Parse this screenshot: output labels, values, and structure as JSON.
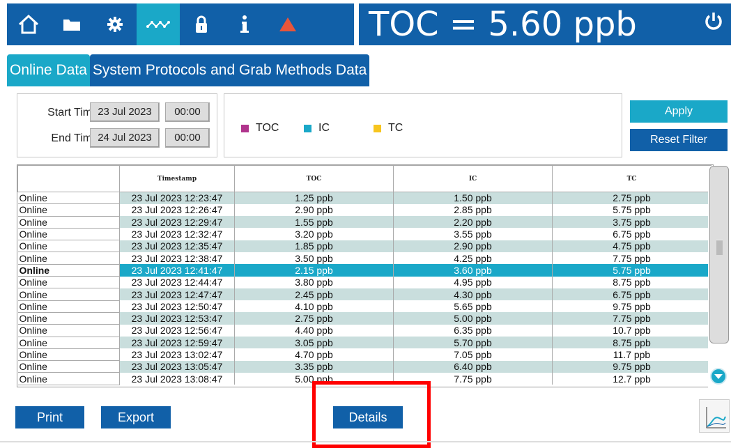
{
  "header": {
    "title": "TOC = 5.60 ppb",
    "nav_icons": [
      "home-icon",
      "folder-icon",
      "gear-icon",
      "waveform-icon",
      "lock-icon",
      "info-icon",
      "alert-triangle-icon"
    ],
    "active_nav": 3,
    "alert_color": "#e8553a"
  },
  "tabs": [
    {
      "label": "Online Data",
      "active": true
    },
    {
      "label": "System Protocols and Grab Methods Data",
      "active": false
    }
  ],
  "filter": {
    "start_label": "Start Time",
    "start_date": "23 Jul 2023",
    "start_time": "00:00",
    "end_label": "End Time",
    "end_date": "24 Jul 2023",
    "end_time": "00:00"
  },
  "legend": [
    {
      "label": "TOC",
      "color": "#b0348c"
    },
    {
      "label": "IC",
      "color": "#1aa8c8"
    },
    {
      "label": "TC",
      "color": "#f7c51e"
    }
  ],
  "buttons": {
    "apply": "Apply",
    "reset": "Reset Filter",
    "print": "Print",
    "export": "Export",
    "details": "Details"
  },
  "table": {
    "headers": [
      "",
      "Timestamp",
      "TOC",
      "IC",
      "TC"
    ],
    "selected_row": 6,
    "rows": [
      [
        "Online",
        "23 Jul 2023 12:23:47",
        "1.25 ppb",
        "1.50 ppb",
        "2.75 ppb"
      ],
      [
        "Online",
        "23 Jul 2023 12:26:47",
        "2.90 ppb",
        "2.85 ppb",
        "5.75 ppb"
      ],
      [
        "Online",
        "23 Jul 2023 12:29:47",
        "1.55 ppb",
        "2.20 ppb",
        "3.75 ppb"
      ],
      [
        "Online",
        "23 Jul 2023 12:32:47",
        "3.20 ppb",
        "3.55 ppb",
        "6.75 ppb"
      ],
      [
        "Online",
        "23 Jul 2023 12:35:47",
        "1.85 ppb",
        "2.90 ppb",
        "4.75 ppb"
      ],
      [
        "Online",
        "23 Jul 2023 12:38:47",
        "3.50 ppb",
        "4.25 ppb",
        "7.75 ppb"
      ],
      [
        "Online",
        "23 Jul 2023 12:41:47",
        "2.15 ppb",
        "3.60 ppb",
        "5.75 ppb"
      ],
      [
        "Online",
        "23 Jul 2023 12:44:47",
        "3.80 ppb",
        "4.95 ppb",
        "8.75 ppb"
      ],
      [
        "Online",
        "23 Jul 2023 12:47:47",
        "2.45 ppb",
        "4.30 ppb",
        "6.75 ppb"
      ],
      [
        "Online",
        "23 Jul 2023 12:50:47",
        "4.10 ppb",
        "5.65 ppb",
        "9.75 ppb"
      ],
      [
        "Online",
        "23 Jul 2023 12:53:47",
        "2.75 ppb",
        "5.00 ppb",
        "7.75 ppb"
      ],
      [
        "Online",
        "23 Jul 2023 12:56:47",
        "4.40 ppb",
        "6.35 ppb",
        "10.7 ppb"
      ],
      [
        "Online",
        "23 Jul 2023 12:59:47",
        "3.05 ppb",
        "5.70 ppb",
        "8.75 ppb"
      ],
      [
        "Online",
        "23 Jul 2023 13:02:47",
        "4.70 ppb",
        "7.05 ppb",
        "11.7 ppb"
      ],
      [
        "Online",
        "23 Jul 2023 13:05:47",
        "3.35 ppb",
        "6.40 ppb",
        "9.75 ppb"
      ],
      [
        "Online",
        "23 Jul 2023 13:08:47",
        "5.00 ppb",
        "7.75 ppb",
        "12.7 ppb"
      ]
    ]
  }
}
